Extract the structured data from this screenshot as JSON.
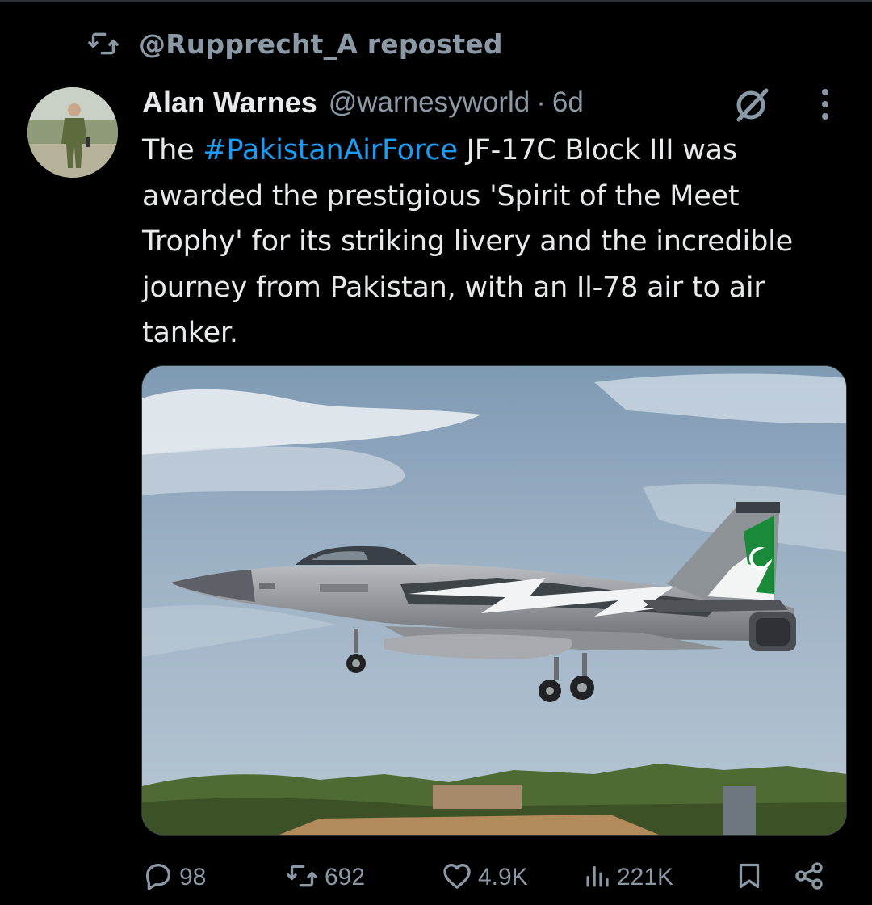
{
  "repost": {
    "icon": "repost-icon",
    "text": "@Rupprecht_A reposted"
  },
  "post": {
    "author": {
      "name": "Alan Warnes",
      "handle": "@warnesyworld",
      "avatar": "avatar-photo"
    },
    "separator": "·",
    "age": "6d",
    "body": {
      "lead": "The ",
      "hashtag": "#PakistanAirForce",
      "rest": " JF-17C Block III was awarded the prestigious 'Spirit of the Meet Trophy' for its striking livery and the incredible journey from Pakistan, with an Il-78 air to air tanker."
    },
    "media": {
      "type": "photo",
      "subject": "jf17-jet-photo"
    }
  },
  "actions": {
    "replies": {
      "icon": "reply-icon",
      "count": "98"
    },
    "reposts": {
      "icon": "repost-icon",
      "count": "692"
    },
    "likes": {
      "icon": "heart-icon",
      "count": "4.9K"
    },
    "views": {
      "icon": "views-icon",
      "count": "221K"
    },
    "bookmark": {
      "icon": "bookmark-icon"
    },
    "share": {
      "icon": "share-icon"
    }
  },
  "colors": {
    "background": "#000000",
    "text": "#e7e9ea",
    "muted": "#8b98a5",
    "link": "#1d9bf0"
  }
}
